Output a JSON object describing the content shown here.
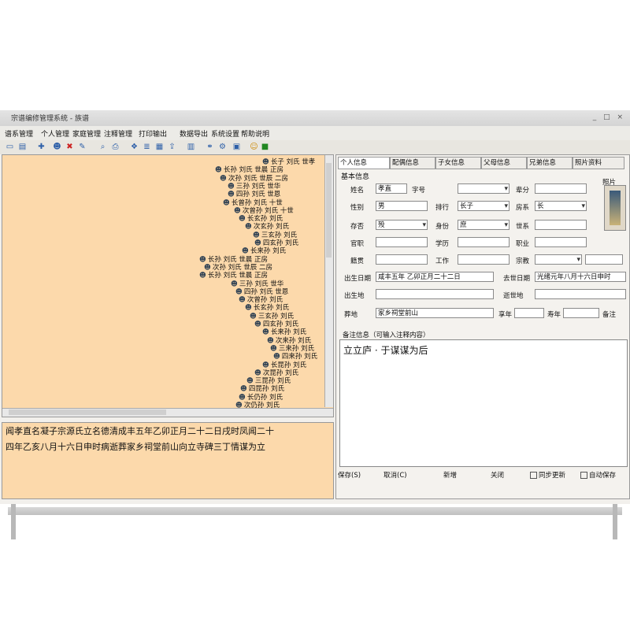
{
  "window": {
    "title": "宗谱编修管理系统 - 族谱",
    "controls": "_ □ ×"
  },
  "menubar": [
    "谱系管理",
    "个人管理",
    "家庭管理",
    "注释管理",
    "打印输出",
    "数据导出",
    "系统设置",
    "帮助说明"
  ],
  "toolbar": [
    "open-icon",
    "save-icon",
    "add-icon",
    "delete-icon",
    "edit-icon",
    "search-icon",
    "print-icon",
    "tree-icon",
    "chart-icon",
    "settings-icon",
    "help-icon",
    "exit-icon"
  ],
  "tree": {
    "nodes": [
      "长子  刘氏  世孝",
      "长孙  刘氏  世晨  正房",
      "次孙  刘氏  世辰  二房",
      "三孙  刘氏  世华",
      "四孙  刘氏  世恩",
      "长曾孙  刘氏  十世",
      "次曾孙  刘氏  十世",
      "长玄孙  刘氏",
      "次玄孙  刘氏",
      "三玄孙  刘氏",
      "四玄孙  刘氏",
      "长来孙  刘氏",
      "长孙  刘氏  世晨  正房",
      "次孙  刘氏  世辰  二房",
      "长孙  刘氏  世晨  正房",
      "三孙  刘氏  世华",
      "四孙  刘氏  世恩",
      "次曾孙  刘氏",
      "长玄孙  刘氏",
      "三玄孙  刘氏",
      "四玄孙  刘氏",
      "长来孙  刘氏",
      "次来孙  刘氏",
      "三来孙  刘氏",
      "四来孙  刘氏",
      "长昆孙  刘氏",
      "次昆孙  刘氏",
      "三昆孙  刘氏",
      "四昆孙  刘氏",
      "长仍孙  刘氏",
      "次仍孙  刘氏"
    ]
  },
  "biography": {
    "line1": "闻孝直名凝子宗源氏立名德清成丰五年乙卯正月二十二日戌时凤闻二十",
    "line2": "四年乙亥八月十六日申时病逝葬家乡祠堂前山向立寺碑三丁情谋为立"
  },
  "right": {
    "tabs": [
      "个人信息",
      "配偶信息",
      "子女信息",
      "父母信息",
      "兄弟信息",
      "照片资料"
    ],
    "group_label": "基本信息",
    "photo_label": "照片",
    "fields": {
      "name_label": "姓名",
      "name_value": "孝直",
      "alias_label": "字号",
      "alias_value": "",
      "gen_label": "辈分",
      "gen_value": "",
      "style_label": "谱名",
      "style_value": "",
      "gender_label": "性别",
      "gender_value": "男",
      "rank_label": "排行",
      "rank_value": "长子",
      "order_label": "房系",
      "order_value": "长",
      "alive_label": "存否",
      "alive_value": "殁",
      "status_label": "身份",
      "status_value": "庶",
      "line_label": "世系",
      "line_value": "",
      "title_label": "官职",
      "title_value": "",
      "edu_label": "学历",
      "edu_value": "",
      "occupation_label": "职业",
      "occupation_value": "",
      "native_label": "籍贯",
      "native_value": "",
      "job_label": "工作",
      "job_value": "",
      "rel_label": "宗教",
      "rel_value": "",
      "birth_label": "出生日期",
      "birth_value": "咸丰五年 乙卯正月二十二日",
      "death_label": "去世日期",
      "death_value": "光绪元年八月十六日申时",
      "birthplace_label": "出生地",
      "birthplace_value": "",
      "deathplace_label": "逝世地",
      "deathplace_value": "",
      "burial_label": "葬地",
      "burial_value": "家乡祠堂前山",
      "age_label": "享年",
      "age_value": "",
      "years_label": "寿年",
      "years_value": "",
      "extra_label": "备注"
    },
    "note_label": "备注信息（可输入注释内容）",
    "note_text": "立立庐 · 于谋谋为后",
    "buttons": {
      "save": "保存(S)",
      "cancel": "取消(C)",
      "new": "新增",
      "close": "关闭",
      "check1": "同步更新",
      "check2": "自动保存"
    }
  }
}
